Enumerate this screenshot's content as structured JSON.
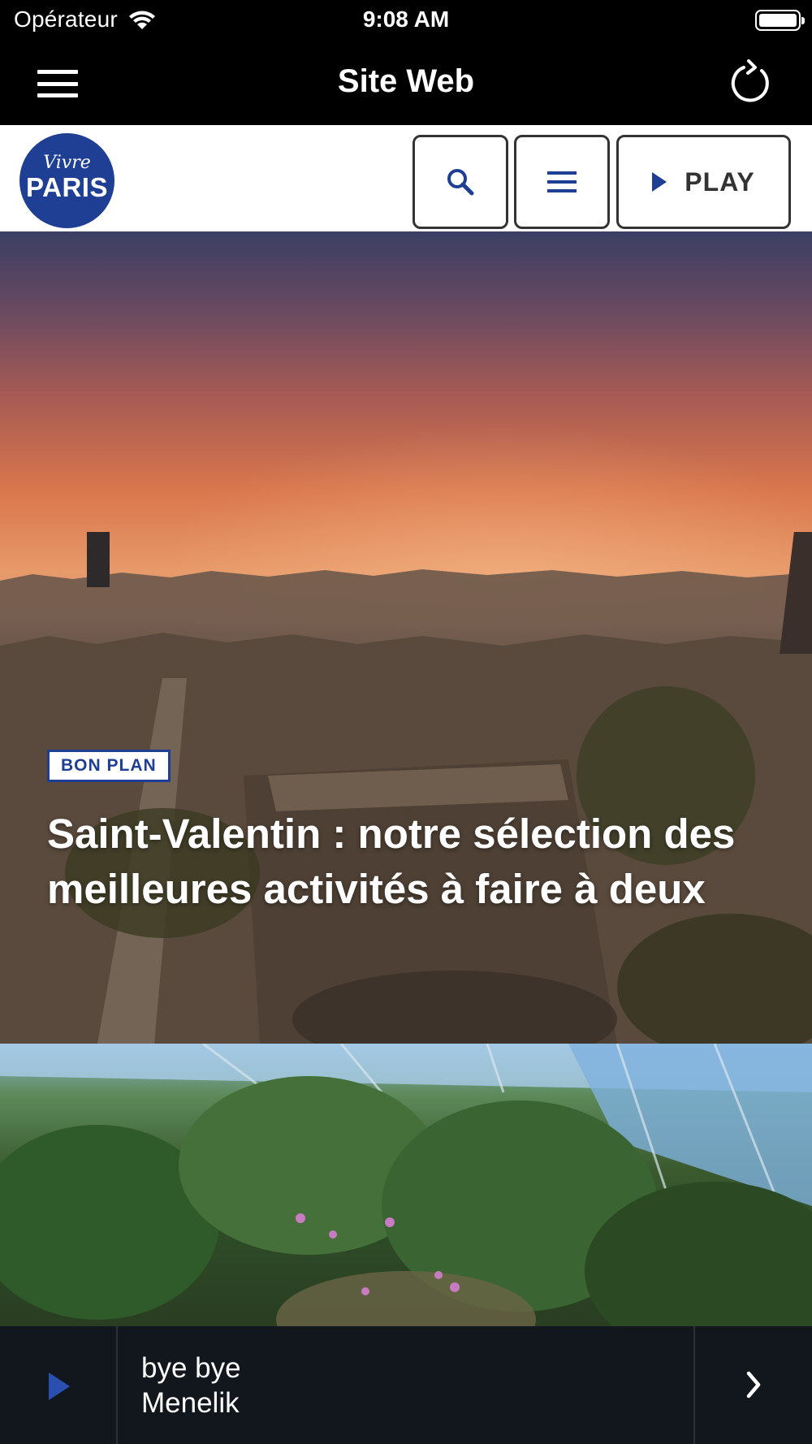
{
  "status_bar": {
    "carrier": "Opérateur",
    "time": "9:08 AM",
    "wifi_icon": "wifi-icon",
    "battery_icon": "battery-icon"
  },
  "app_nav": {
    "title": "Site Web",
    "menu_icon": "hamburger-icon",
    "refresh_icon": "refresh-icon"
  },
  "site_header": {
    "logo_script": "Vivre",
    "logo_main": "PARIS",
    "search_icon": "search-icon",
    "menu_icon": "menu-icon",
    "play_label": "PLAY",
    "brand_color": "#1e3f94"
  },
  "hero_article": {
    "tag": "BON PLAN",
    "title": "Saint-Valentin : notre sélection des meilleures activités à faire à deux"
  },
  "player": {
    "track_line1": "bye bye",
    "track_line2": "Menelik",
    "play_icon": "play-icon",
    "next_icon": "chevron-right-icon"
  }
}
